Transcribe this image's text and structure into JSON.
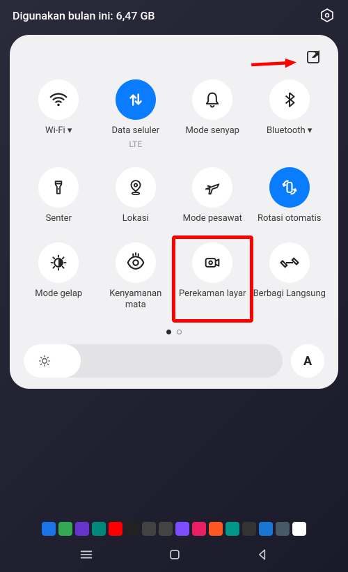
{
  "header": {
    "usage_text": "Digunakan bulan ini: 6,47 GB"
  },
  "panel": {
    "edit_icon": "edit",
    "tiles": [
      {
        "label": "Wi-Fi ▾",
        "sub": ""
      },
      {
        "label": "Data seluler",
        "sub": "LTE"
      },
      {
        "label": "Mode senyap",
        "sub": ""
      },
      {
        "label": "Bluetooth ▾",
        "sub": ""
      },
      {
        "label": "Senter",
        "sub": ""
      },
      {
        "label": "Lokasi",
        "sub": ""
      },
      {
        "label": "Mode pesawat",
        "sub": ""
      },
      {
        "label": "Rotasi otomatis",
        "sub": ""
      },
      {
        "label": "Mode gelap",
        "sub": ""
      },
      {
        "label": "Kenyamanan mata",
        "sub": ""
      },
      {
        "label": "Perekaman layar",
        "sub": ""
      },
      {
        "label": "Berbagi Langsung",
        "sub": ""
      }
    ],
    "auto_label": "A"
  },
  "colors": {
    "accent": "#0a7cff",
    "highlight": "#ff0000"
  }
}
